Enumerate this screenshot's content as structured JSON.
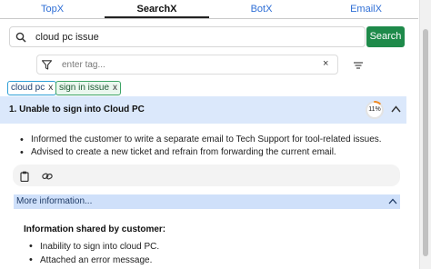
{
  "tabs": [
    {
      "label": "TopX",
      "active": false
    },
    {
      "label": "SearchX",
      "active": true
    },
    {
      "label": "BotX",
      "active": false
    },
    {
      "label": "EmailX",
      "active": false
    }
  ],
  "search": {
    "value": "cloud pc issue",
    "button_label": "Search",
    "icon": "search-icon"
  },
  "tag_filter": {
    "placeholder": "enter tag...",
    "clear_glyph": "×",
    "icon": "filter-icon"
  },
  "chips": [
    {
      "label": "cloud pc",
      "remove": "x"
    },
    {
      "label": "sign in issue",
      "remove": "x"
    }
  ],
  "result": {
    "title": "1. Unable to sign into Cloud PC",
    "match_percent": "11%",
    "match_value": 0.11,
    "bullets": [
      "Informed the customer to write a separate email to Tech Support for tool-related issues.",
      "Advised to create a new ticket and refrain from forwarding the current email."
    ],
    "actions": [
      "clipboard-icon",
      "link-icon"
    ]
  },
  "more_info": {
    "label": "More information...",
    "section_title": "Information shared by customer:",
    "items": [
      "Inability to sign into cloud PC.",
      "Attached an error message."
    ]
  },
  "colors": {
    "accent_blue": "#2f6fd6",
    "search_button": "#1e8a4a",
    "header_bg": "#dbe8fb",
    "progress_ring": "#f08a24"
  }
}
